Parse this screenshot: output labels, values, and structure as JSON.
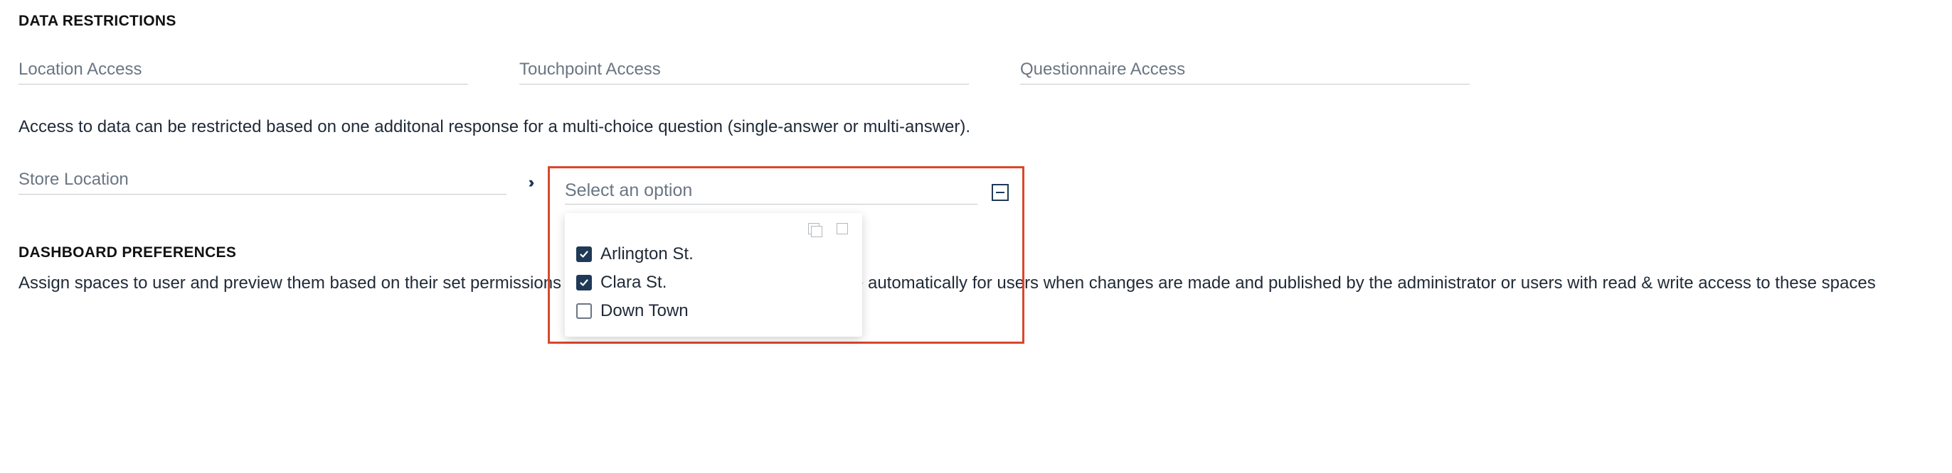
{
  "sections": {
    "data_restrictions": {
      "title": "DATA RESTRICTIONS",
      "fields": {
        "location_access": {
          "label": "Location Access"
        },
        "touchpoint_access": {
          "label": "Touchpoint Access"
        },
        "questionnaire_access": {
          "label": "Questionnaire Access"
        }
      },
      "help": "Access to data can be restricted based on one additonal response for a multi-choice question (single-answer or multi-answer).",
      "restriction": {
        "label": "Store Location",
        "select_placeholder": "Select an option",
        "options": [
          {
            "label": "Arlington St.",
            "checked": true
          },
          {
            "label": "Clara St.",
            "checked": true
          },
          {
            "label": "Down Town",
            "checked": false
          }
        ]
      }
    },
    "dashboard_preferences": {
      "title": "DASHBOARD PREFERENCES",
      "description": "Assign spaces to user and preview them based on their set permissions and data restriction. Spaces will update automatically for users when changes are made and published by the administrator or users with read & write access to these spaces"
    }
  },
  "colors": {
    "accent": "#1f3a57",
    "highlight": "#d9472b",
    "text": "#1f2a37",
    "muted": "#6b7683",
    "border": "#c4c8cc"
  }
}
